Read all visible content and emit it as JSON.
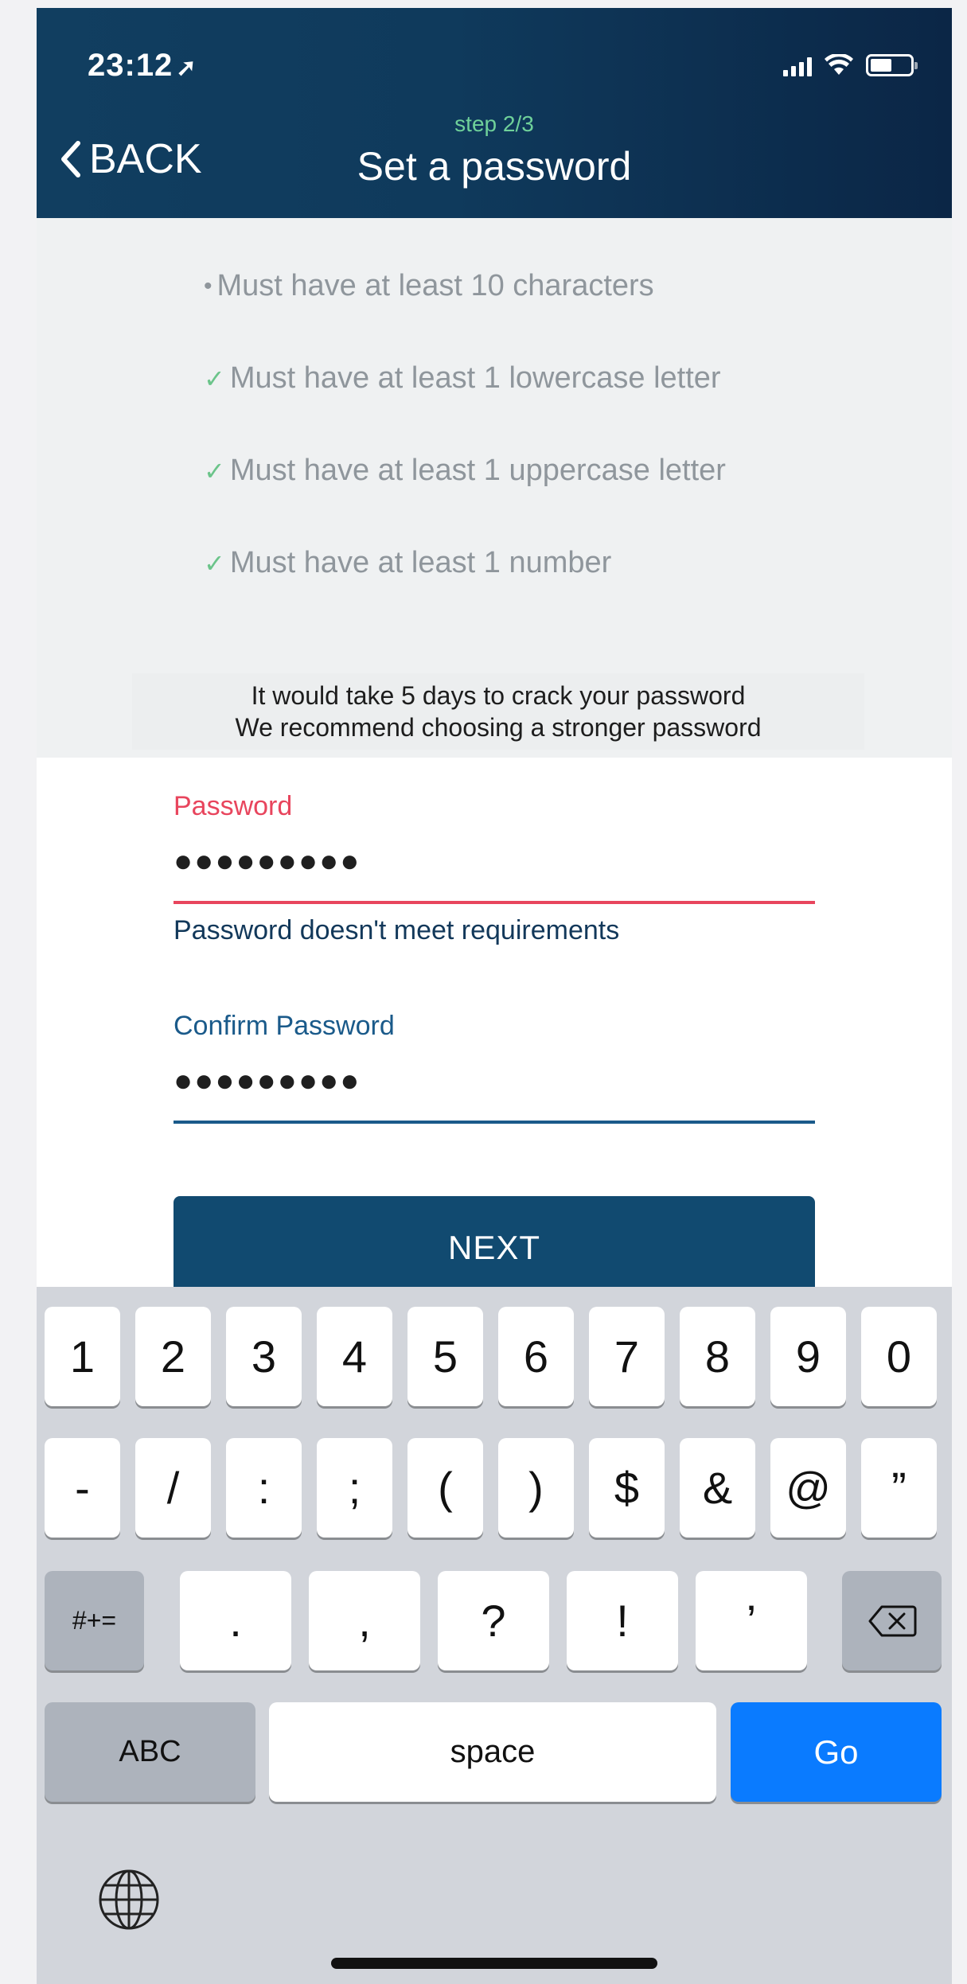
{
  "status_bar": {
    "time": "23:12",
    "location_arrow": "➤"
  },
  "header": {
    "back_label": "BACK",
    "step": "step 2/3",
    "title": "Set a password"
  },
  "requirements": [
    {
      "marker": "•",
      "text": "Must have at least 10 characters",
      "met": false
    },
    {
      "marker": "✓",
      "text": "Must have at least 1 lowercase letter",
      "met": true
    },
    {
      "marker": "✓",
      "text": "Must have at least 1 uppercase letter",
      "met": true
    },
    {
      "marker": "✓",
      "text": "Must have at least 1 number",
      "met": true
    }
  ],
  "strength": {
    "line1": "It would take 5 days to crack your password",
    "line2": "We recommend choosing a stronger password"
  },
  "password_field": {
    "label": "Password",
    "value": "●●●●●●●●●",
    "error": "Password doesn't meet requirements",
    "color": "#e8455d"
  },
  "confirm_field": {
    "label": "Confirm Password",
    "value": "●●●●●●●●●",
    "color": "#1a5a8a"
  },
  "next_button": {
    "label": "NEXT"
  },
  "keyboard": {
    "row1": [
      "1",
      "2",
      "3",
      "4",
      "5",
      "6",
      "7",
      "8",
      "9",
      "0"
    ],
    "row2": [
      "-",
      "/",
      ":",
      ";",
      "(",
      ")",
      "$",
      "&",
      "@",
      "”"
    ],
    "row3": {
      "shift": "#+=",
      "keys": [
        ".",
        ",",
        "?",
        "!",
        "’"
      ],
      "delete_icon": "backspace-icon"
    },
    "row4": {
      "abc": "ABC",
      "space": "space",
      "go": "Go"
    },
    "globe_icon": "globe-icon"
  }
}
